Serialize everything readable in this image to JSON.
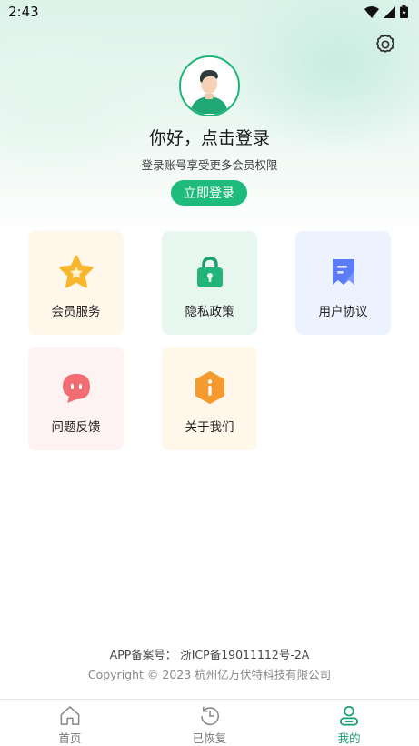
{
  "status_bar": {
    "time": "2:43"
  },
  "profile": {
    "greeting": "你好，点击登录",
    "subtitle": "登录账号享受更多会员权限",
    "login_button": "立即登录"
  },
  "grid": {
    "items": [
      {
        "label": "会员服务",
        "icon": "star-icon"
      },
      {
        "label": "隐私政策",
        "icon": "lock-icon"
      },
      {
        "label": "用户协议",
        "icon": "document-icon"
      },
      {
        "label": "问题反馈",
        "icon": "chat-bubble-icon"
      },
      {
        "label": "关于我们",
        "icon": "info-icon"
      }
    ]
  },
  "footer": {
    "icp": "APP备案号： 浙ICP备19011112号-2A",
    "copyright": "Copyright © 2023 杭州亿万伏特科技有限公司"
  },
  "tabbar": {
    "tabs": [
      {
        "label": "首页",
        "icon": "home-icon",
        "active": false
      },
      {
        "label": "已恢复",
        "icon": "history-icon",
        "active": false
      },
      {
        "label": "我的",
        "icon": "user-icon",
        "active": true
      }
    ],
    "active_color": "#1a9f6d"
  },
  "colors": {
    "accent": "#1fbb7d"
  }
}
